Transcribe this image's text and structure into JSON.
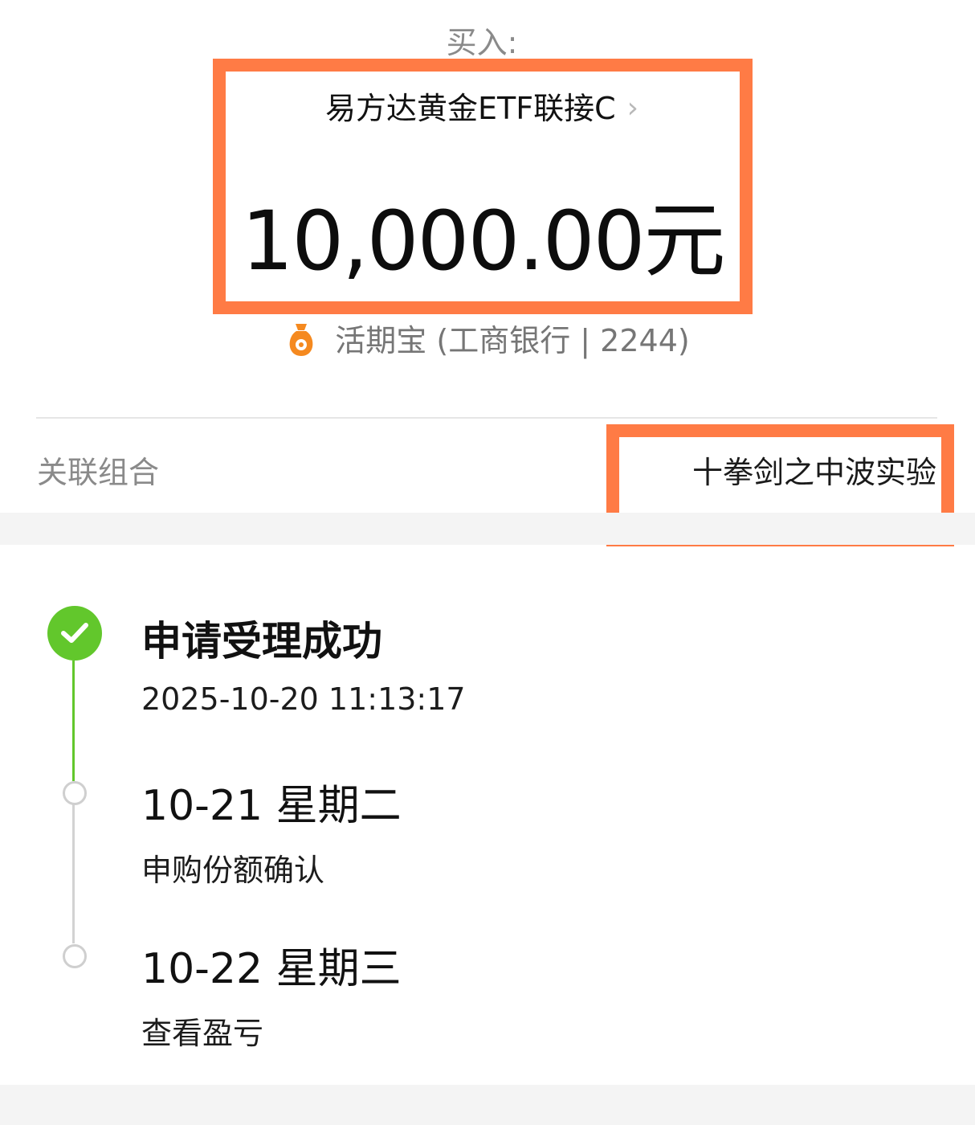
{
  "header": {
    "buy_label": "买入:"
  },
  "fund": {
    "name": "易方达黄金ETF联接C",
    "chevron": "›",
    "amount": "10,000.00元"
  },
  "payment": {
    "icon": "money-bag-icon",
    "text": "活期宝 (工商银行 | 2244)"
  },
  "combo": {
    "label": "关联组合",
    "value": "十拳剑之中波实验"
  },
  "timeline": {
    "steps": [
      {
        "title": "申请受理成功",
        "subtitle": "2025-10-20 11:13:17",
        "status": "done"
      },
      {
        "title": "10-21 星期二",
        "subtitle": "申购份额确认",
        "status": "pending"
      },
      {
        "title": "10-22 星期三",
        "subtitle": "查看盈亏",
        "status": "pending"
      }
    ]
  },
  "colors": {
    "highlight": "#ff7b45",
    "done_green": "#62c72c",
    "bag_orange": "#f5891f"
  }
}
